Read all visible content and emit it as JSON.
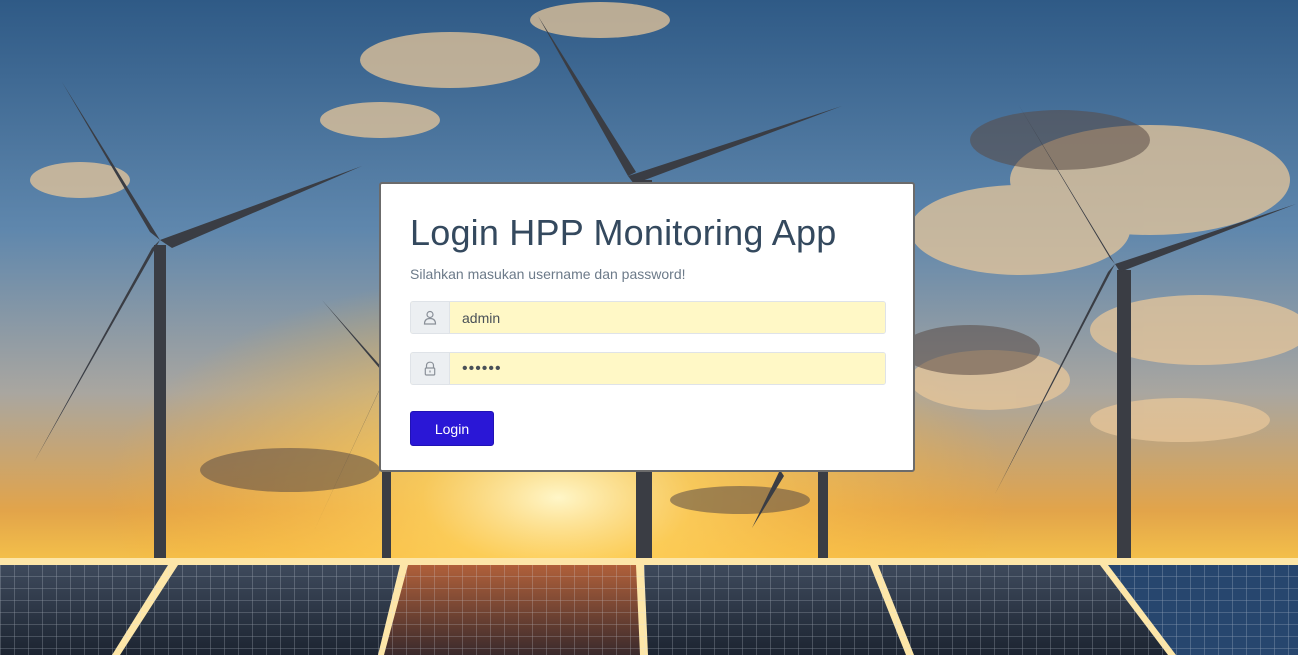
{
  "login": {
    "title": "Login HPP Monitoring App",
    "subtitle": "Silahkan masukan username dan password!",
    "username": {
      "value": "admin",
      "icon": "user-icon"
    },
    "password": {
      "value": "••••••",
      "icon": "lock-icon"
    },
    "button_label": "Login"
  },
  "colors": {
    "button": "#2a17d6",
    "input_autofill_bg": "#fff8c6",
    "title_text": "#34495e"
  }
}
